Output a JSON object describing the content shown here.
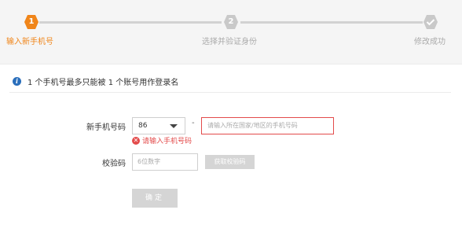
{
  "steps": [
    {
      "number": "1",
      "label": "输入新手机号",
      "state": "active"
    },
    {
      "number": "2",
      "label": "选择并验证身份",
      "state": "pending"
    },
    {
      "number": "",
      "label": "修改成功",
      "state": "pending",
      "icon": "check-icon"
    }
  ],
  "colors": {
    "accent": "#f08519",
    "pending": "#c9c9c9",
    "error": "#e34b4b",
    "info": "#2a6ebb"
  },
  "notice": {
    "text": "1 个手机号最多只能被 1 个账号用作登录名"
  },
  "form": {
    "phone_label": "新手机号码",
    "country_code": "86",
    "separator": "-",
    "phone_placeholder": "请输入所在国家/地区的手机号码",
    "phone_error": "请输入手机号码",
    "code_label": "校验码",
    "code_placeholder": "6位数字",
    "get_code_label": "获取校验码",
    "confirm_label": "确定"
  }
}
